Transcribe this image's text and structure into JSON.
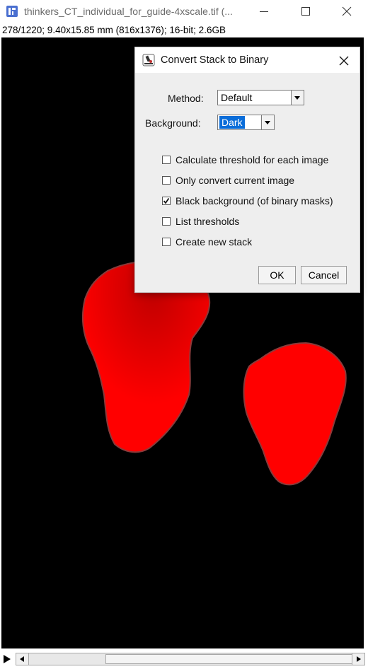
{
  "window": {
    "title": "thinkers_CT_individual_for_guide-4xscale.tif (...",
    "info": "278/1220; 9.40x15.85 mm (816x1376); 16-bit; 2.6GB",
    "controls": [
      "minimize-icon",
      "maximize-icon",
      "close-icon"
    ]
  },
  "colors": {
    "mask": "#ff0000",
    "canvas": "#000000",
    "selection": "#0a6dd9"
  },
  "dialog": {
    "title": "Convert Stack to Binary",
    "method_label": "Method:",
    "method_value": "Default",
    "background_label": "Background:",
    "background_value": "Dark",
    "options": [
      {
        "label": "Calculate threshold for each image",
        "checked": false
      },
      {
        "label": "Only convert current image",
        "checked": false
      },
      {
        "label": "Black background (of binary masks)",
        "checked": true
      },
      {
        "label": "List thresholds",
        "checked": false
      },
      {
        "label": "Create new stack",
        "checked": false
      }
    ],
    "ok_label": "OK",
    "cancel_label": "Cancel"
  },
  "stack_slider": {
    "current": 278,
    "total": 1220
  }
}
